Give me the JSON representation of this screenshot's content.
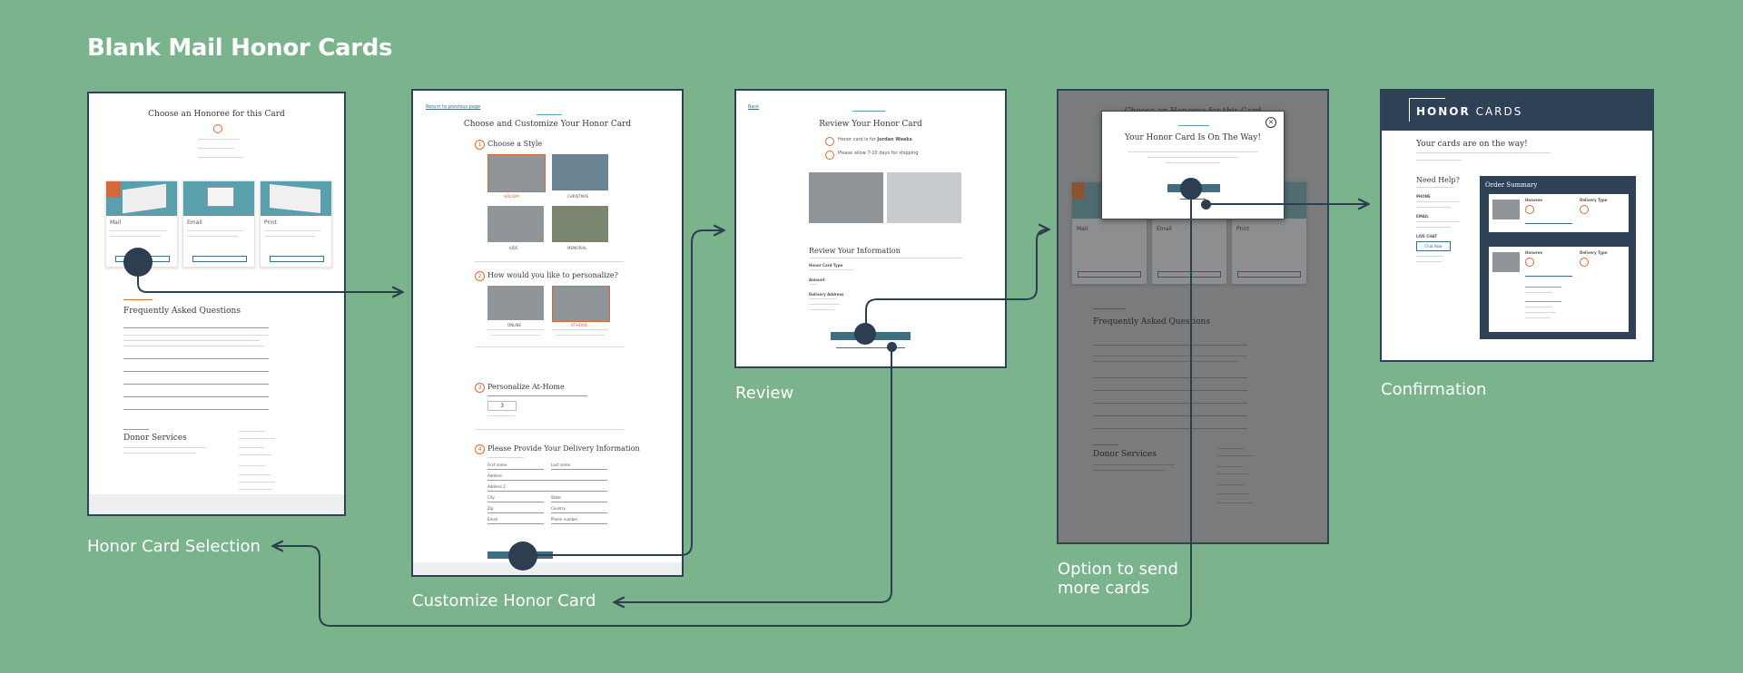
{
  "title": "Blank Mail Honor Cards",
  "colors": {
    "background": "#7ab38c",
    "frame": "#2e4356",
    "accent": "#d46a3a",
    "teal": "#5aa0ac",
    "navy": "#2f4156"
  },
  "captions": {
    "selection": "Honor Card Selection",
    "customize": "Customize Honor Card",
    "review": "Review",
    "option": [
      "Option to send",
      "more cards"
    ],
    "confirmation": "Confirmation"
  },
  "screen1": {
    "heading": "Choose an Honoree for this Card",
    "card_titles": [
      "Mail",
      "Email",
      "Print"
    ],
    "faq_heading": "Frequently Asked Questions",
    "donor_heading": "Donor Services"
  },
  "screen2": {
    "back_link": "Return to previous page",
    "heading": "Choose and Customize Your Honor Card",
    "step1": "Choose a Style",
    "styles": [
      "HOLIDAY",
      "CHRISTMAS",
      "KIDS",
      "MEMORIAL"
    ],
    "step2": "How would you like to personalize?",
    "personalize": [
      "ONLINE",
      "AT-HOME"
    ],
    "step3": "Personalize At-Home",
    "qty": "3",
    "step4": "Please Provide Your Delivery Information",
    "fields": [
      "First name",
      "Last name",
      "Address",
      "Address 2",
      "City",
      "State",
      "Zip",
      "Country",
      "Email",
      "Phone number"
    ]
  },
  "screen3": {
    "back_link": "Back",
    "heading": "Review Your Honor Card",
    "line1_prefix": "Honor card is for ",
    "line1_name": "Jordan Weeks",
    "line2": "Please allow 7-10 days for shipping",
    "info_heading": "Review Your Information",
    "labels": [
      "Honor Card Type",
      "Amount",
      "Delivery Address"
    ]
  },
  "screen4": {
    "bg_heading": "Choose an Honoree for this Card",
    "modal_heading": "Your Honor Card Is On The Way!",
    "card_titles": [
      "Mail",
      "Email",
      "Print"
    ],
    "faq_heading": "Frequently Asked Questions",
    "donor_heading": "Donor Services"
  },
  "screen5": {
    "brand_bold": "HONOR",
    "brand_light": "CARDS",
    "heading": "Your cards are on the way!",
    "help_heading": "Need Help?",
    "contacts": [
      "PHONE",
      "EMAIL",
      "LIVE CHAT"
    ],
    "chat_button": "Chat Now",
    "summary_heading": "Order Summary",
    "item_labels": [
      "Honoree",
      "Delivery Type"
    ]
  }
}
